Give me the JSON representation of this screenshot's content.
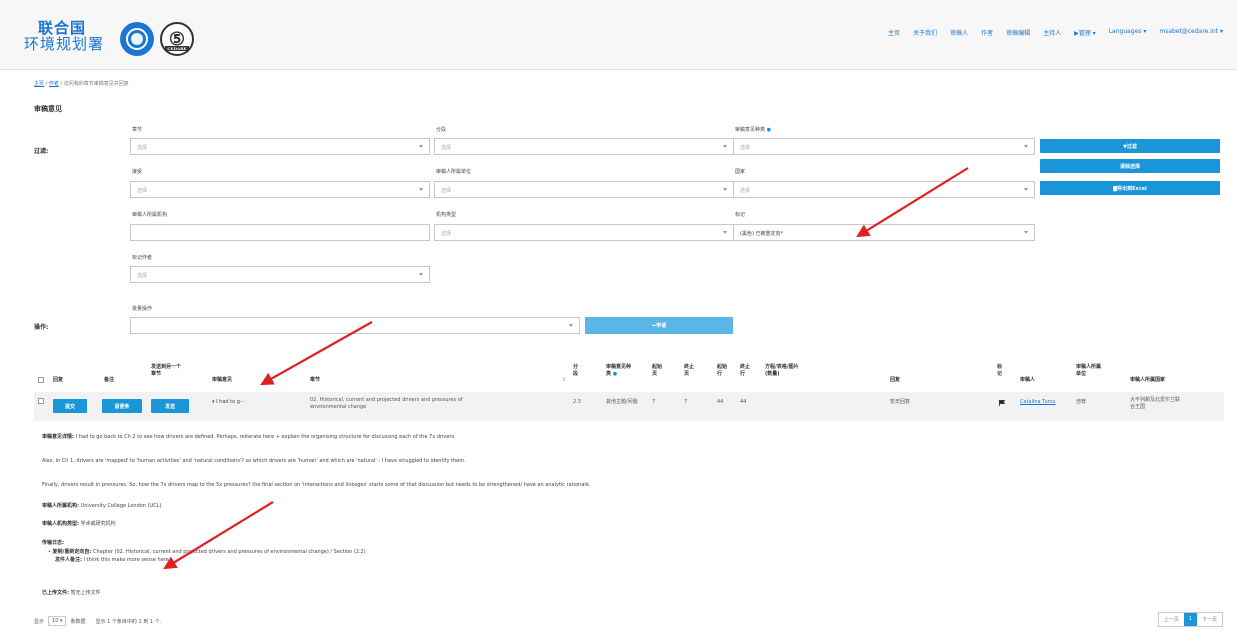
{
  "header": {
    "logo_line1": "联合国",
    "logo_line2": "环境规划署",
    "cedare_glyph": "⑤",
    "cedare_caption": "CEDARE",
    "nav": [
      "主页",
      "关于我们",
      "审稿人",
      "作者",
      "审稿编辑",
      "主持人",
      "▶管理 ▾",
      "Languages ▾",
      "msabet@cedare.int ▾"
    ]
  },
  "breadcrumb": {
    "home": "主页",
    "sep1": " / ",
    "authors": "作者",
    "sep2": " / ",
    "current": "访问我的章节审稿意见并回复"
  },
  "section_title": "审稿意见",
  "filters": {
    "label": "过滤:",
    "chapter_label": "章节",
    "chapter_placeholder": "选择",
    "section_label": "分段",
    "section_placeholder": "选择",
    "comment_type_label": "审稿意见种类",
    "comment_type_placeholder": "选择",
    "accept_label": "接受",
    "accept_placeholder": "选择",
    "reviewer_unit_label": "审稿人所属单位",
    "reviewer_unit_placeholder": "选择",
    "country_label": "国家",
    "country_placeholder": "选择",
    "reviewer_org_label": "审稿人所属机构",
    "org_type_label": "机构类型",
    "org_type_placeholder": "选择",
    "mark_label": "标记",
    "mark_value": "(黑色) 已被重定向*",
    "mark_author_label": "标记作者",
    "mark_author_placeholder": "选择",
    "btn_filter": "▼过滤",
    "btn_clear": "清除选择",
    "btn_export": "▇导出到Excel"
  },
  "bulk": {
    "label": "操作:",
    "field_label": "批量操作",
    "apply_label": "➦申请"
  },
  "table": {
    "headers": {
      "reply": "回复",
      "note": "备注",
      "send_to_line1": "发送到另一个",
      "send_to_line2": "章节",
      "comment": "审稿意见",
      "chapter": "章节",
      "sort": "⇅",
      "section_line1": "分",
      "section_line2": "段",
      "ctype_line1": "审稿意见种",
      "ctype_line2": "类",
      "start_page_line1": "起始",
      "start_page_line2": "页",
      "end_page_line1": "终止",
      "end_page_line2": "页",
      "start_line_line1": "起始",
      "start_line_line2": "行",
      "end_line_line1": "终止",
      "end_line_line2": "行",
      "eq_line1": "方程/表格/图片",
      "eq_line2": "(数量)",
      "response": "回复",
      "mark_line1": "标",
      "mark_line2": "记",
      "reviewer": "审稿人",
      "unit_line1": "审稿人所属",
      "unit_line2": "单位",
      "rcountry": "审稿人所属国家"
    },
    "row": {
      "btn_submit": "提交",
      "btn_note": "留便条",
      "btn_send": "发送",
      "comment": "▾ I had to g···",
      "chapter_line1": "02. Historical, current and projected drivers and pressures of",
      "chapter_line2": "environmental change",
      "section": "2.3",
      "ctype": "其他主题/问题",
      "start_page": "7",
      "end_page": "7",
      "start_line": "44",
      "end_line": "44",
      "response": "暂无回复",
      "reviewer": "Catalina Turcu",
      "unit": "自荐",
      "country_line1": "大不列颠及北爱尔兰联",
      "country_line2": "合王国"
    }
  },
  "detail": {
    "comment_label": "审稿意见详情:",
    "comment_p1": " I had to go back to Ch 2 to see how drivers are defined. Perhaps, reiterate here + explain the organising structure for discussing each of the 7x drivers.",
    "comment_p2": "Also, in Ch 1, drivers are 'mapped' to 'human activities' and 'natural conditions'? so which drivers are 'human' and which are 'natural' - I have struggled to identify them.",
    "comment_p3": "Finally, drivers result in pressures. So, how the 7x drivers map to the 5x pressures? the final section on 'interactions and linkages' starts some of that discussion but needs to be strengthened/ have an analytic rationale.",
    "org_label": "审稿人所属机构:",
    "org_value": " University College London (UCL)",
    "org_type_label": "审稿人机构类型:",
    "org_type_value": " 学术或研究机构",
    "log_label": "传输日志:",
    "log_item_label": "复制/重新定向自:",
    "log_item_value": " Chapter (02. Historical, current and projected drivers and pressures of environmental change) / Section (2.2)",
    "sender_note_label": "发件人备注:",
    "sender_note_value": " I think this make more sense here",
    "uploaded_label": "已上传文件:",
    "uploaded_value": " 暂无上传文件"
  },
  "footer": {
    "show": "显示",
    "page_len": "10  ▾",
    "per_page": "条数据",
    "info": "显示 1 个条目中的 1 到 1 个.",
    "prev": "上一页",
    "page": "1",
    "next": "下一页"
  },
  "colors": {
    "accent": "#1a96d8",
    "annotation_arrow": "#e02020"
  }
}
